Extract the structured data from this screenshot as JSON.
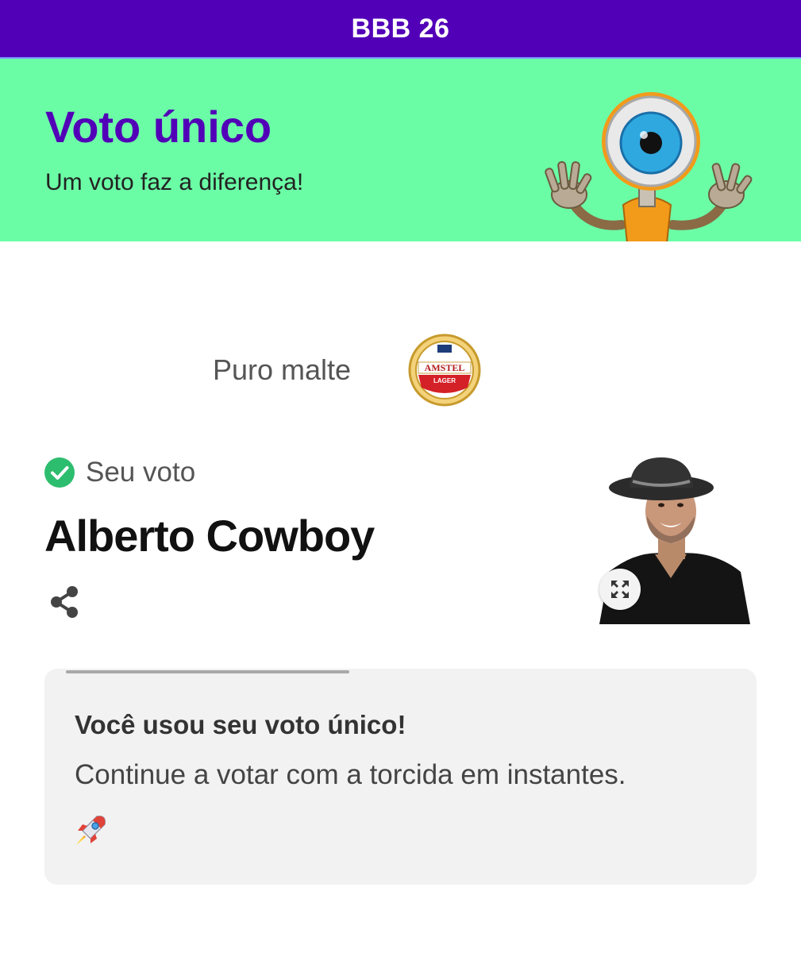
{
  "header": {
    "title": "BBB 26"
  },
  "hero": {
    "title": "Voto único",
    "subtitle": "Um voto faz a diferença!",
    "mascot_icon": "big-brother-eye-mascot",
    "background_color": "#6bfca6",
    "title_color": "#5200b8"
  },
  "sponsor": {
    "label": "Puro malte",
    "logo_icon": "amstel-lager-logo",
    "logo_text": "AMSTEL",
    "logo_subtext": "LAGER"
  },
  "vote": {
    "status_label": "Seu voto",
    "status_icon": "check-circle-icon",
    "candidate_name": "Alberto Cowboy",
    "share_icon": "share-icon",
    "expand_icon": "expand-icon"
  },
  "notice": {
    "title": "Você usou seu voto único!",
    "text": "Continue a votar com a torcida em instantes.",
    "emoji": "🚀",
    "progress": 0.4
  },
  "colors": {
    "brand_purple": "#5200b8",
    "success_green": "#2dbd6e"
  }
}
